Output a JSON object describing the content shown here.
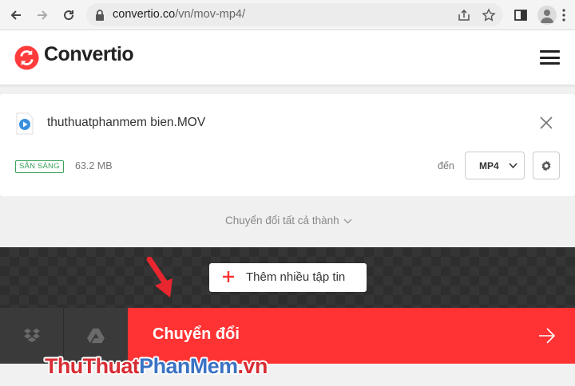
{
  "browser": {
    "url_host": "convertio.co",
    "url_path": "/vn/mov-mp4/"
  },
  "header": {
    "logo_text": "Convertio"
  },
  "file": {
    "name": "thuthuatphanmem bien.MOV",
    "status": "SẴN SÀNG",
    "size": "63.2 MB",
    "to_label": "đến",
    "format": "MP4"
  },
  "convert_all": {
    "label": "Chuyển đổi tất cả thành"
  },
  "dropzone": {
    "add_files_label": "Thêm nhiều tập tin"
  },
  "bottom": {
    "convert_label": "Chuyển đổi"
  },
  "watermark": {
    "part1": "ThuThuat",
    "part2": "PhanMem",
    "part3": ".vn"
  },
  "colors": {
    "accent_red": "#ff3333",
    "ready_green": "#3aa35b",
    "dark_zone": "#2e2e2e"
  }
}
